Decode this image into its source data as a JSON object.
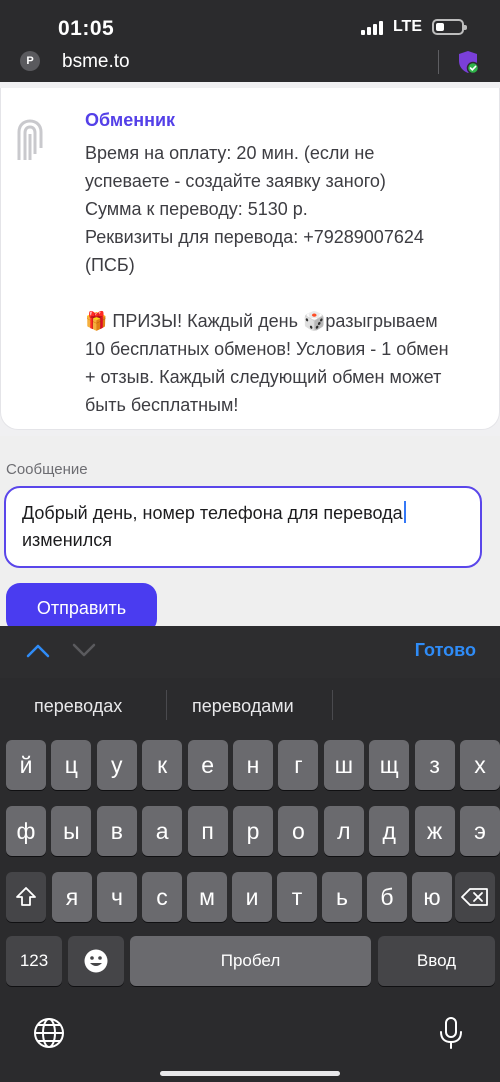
{
  "status": {
    "time": "01:05",
    "network": "LTE"
  },
  "browser": {
    "url": "bsme.to"
  },
  "chat": {
    "sender": "Обменник",
    "lines": [
      "Время на оплату: 20 мин. (если не",
      "успеваете - создайте заявку заного)",
      "Сумма к переводу: 5130 р.",
      "Реквизиты для перевода: +79289007624",
      "(ПСБ)"
    ],
    "promo_lines": [
      "🎁 ПРИЗЫ! Каждый день 🎲разыгрываем",
      "10 бесплатных обменов! Условия - 1 обмен",
      "+ отзыв. Каждый следующий обмен может",
      "быть бесплатным!"
    ]
  },
  "form": {
    "label": "Сообщение",
    "value_line1": "Добрый день, номер телефона для перевода",
    "value_line2": "изменился",
    "send_label": "Отправить"
  },
  "accessory": {
    "done_label": "Готово"
  },
  "keyboard": {
    "suggestions": [
      "переводах",
      "переводами"
    ],
    "row1": [
      "й",
      "ц",
      "у",
      "к",
      "е",
      "н",
      "г",
      "ш",
      "щ",
      "з",
      "х"
    ],
    "row2": [
      "ф",
      "ы",
      "в",
      "а",
      "п",
      "р",
      "о",
      "л",
      "д",
      "ж",
      "э"
    ],
    "row3": [
      "я",
      "ч",
      "с",
      "м",
      "и",
      "т",
      "ь",
      "б",
      "ю"
    ],
    "numbers_label": "123",
    "space_label": "Пробел",
    "return_label": "Ввод"
  },
  "icons": [
    "site-icon",
    "shield-check-icon",
    "chevron-up-icon",
    "chevron-down-icon",
    "shift-icon",
    "delete-icon",
    "emoji-icon",
    "globe-icon",
    "mic-icon"
  ],
  "colors": {
    "accent": "#4a3cf0",
    "sender": "#5440e8",
    "done": "#2f8cf7"
  }
}
